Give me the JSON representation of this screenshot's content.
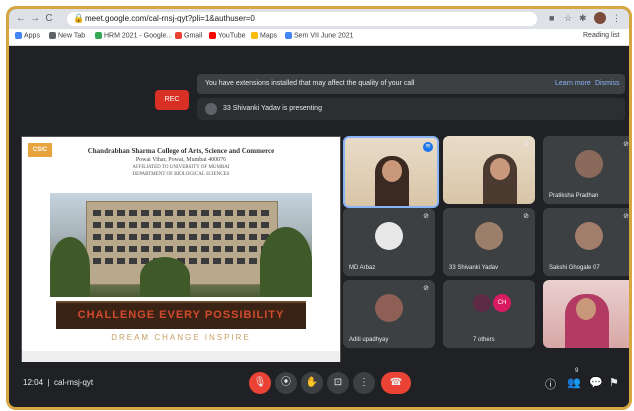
{
  "browser": {
    "url": "meet.google.com/cal-rnsj-qyt?pli=1&authuser=0",
    "nav": {
      "back": "←",
      "forward": "→",
      "reload": "C"
    }
  },
  "bookmarks": [
    {
      "label": "Apps",
      "color": "#4285f4"
    },
    {
      "label": "New Tab",
      "color": "#5f6368"
    },
    {
      "label": "HRM 2021 - Google...",
      "color": "#34a853"
    },
    {
      "label": "Gmail",
      "color": "#ea4335"
    },
    {
      "label": "YouTube",
      "color": "#ff0000"
    },
    {
      "label": "Maps",
      "color": "#fbbc04"
    },
    {
      "label": "Sem VII June 2021",
      "color": "#4285f4"
    }
  ],
  "reading_list": "Reading list",
  "meet": {
    "rec_label": "REC",
    "banner": {
      "message": "You have extensions installed that may affect the quality of your call",
      "learn_more": "Learn more",
      "dismiss": "Dismiss"
    },
    "presenting": "33 Shivanki Yadav is presenting",
    "slide": {
      "logo": "CSIC",
      "line1": "Chandrabhan Sharma College of Arts, Science and Commerce",
      "line2": "Powai Vihar, Powai, Mumbai 400076",
      "line3": "AFFILIATED TO UNIVERSITY OF MUMBAI",
      "line4": "DEPARTMENT OF BIOLOGICAL SCIENCES",
      "motto": "CHALLENGE EVERY POSSIBILITY",
      "tagline": "DREAM  CHANGE  INSPIRE"
    },
    "participants": [
      {
        "name": "",
        "type": "video",
        "active": true
      },
      {
        "name": "",
        "type": "video",
        "active": false
      },
      {
        "name": "Pratiksha Pradhan",
        "type": "avatar"
      },
      {
        "name": "MD Arbaz",
        "type": "avatar"
      },
      {
        "name": "33 Shivanki Yadav",
        "type": "avatar"
      },
      {
        "name": "Sakshi Ghogale 07",
        "type": "avatar"
      },
      {
        "name": "Aditi upadhyay",
        "type": "avatar"
      },
      {
        "name": "7 others",
        "type": "others",
        "initials": "CH"
      },
      {
        "name": "",
        "type": "video-pink"
      }
    ],
    "meeting_time": "12:04",
    "meeting_code": "cal-rnsj-qyt",
    "controls": {
      "mic": "🎙",
      "camera": "⦿",
      "hand": "✋",
      "present": "⊡",
      "more": "⋮",
      "end": "☎"
    },
    "right_icons": {
      "info": "ⓘ",
      "people": "👥",
      "chat": "💬",
      "activities": "⚑"
    },
    "participant_count": "9"
  }
}
